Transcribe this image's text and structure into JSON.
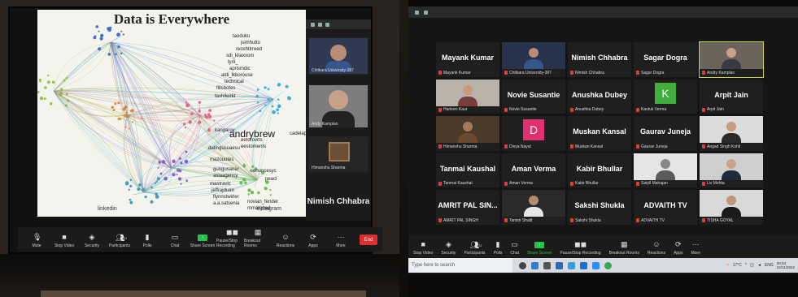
{
  "left": {
    "slide": {
      "title": "Data is Everywhere",
      "network_labels": [
        "taoduku",
        "jsimhutto",
        "reoshtlrreed",
        "sdi_kliaxxom",
        "tyrii_",
        "aprismdic",
        "aldi_lkborouse",
        "technical",
        "fillsbotes",
        "tashlleirkt",
        "kangaroy",
        "datingusuaesu",
        "mazouutes",
        "gungusaner",
        "asiaagency",
        "mastravic",
        "jeffrajduan",
        "flynnstwirler",
        "a.a.satsenia",
        "novian_fender",
        "mmatgbed",
        "cadelapmo",
        "eetorovrts",
        "senuncesyc",
        "peacl",
        "eestoments"
      ],
      "big_label": "andrybrew",
      "bottom_left": "linkedin",
      "bottom_right": "instagram"
    },
    "side_panel": {
      "tiles": [
        {
          "label": "Chitkara University-387"
        },
        {
          "label": "Andy Kamplan"
        },
        {
          "label": "Himanshu Sharma"
        }
      ],
      "big_name": "Nimish Chhabra"
    },
    "toolbar": [
      {
        "label": "Mute",
        "icon": "mic-icon"
      },
      {
        "label": "Stop Video",
        "icon": "video-icon"
      },
      {
        "label": "Security",
        "icon": "shield-icon"
      },
      {
        "label": "Participants",
        "icon": "people-icon",
        "count": "31"
      },
      {
        "label": "Polls",
        "icon": "polls-icon"
      },
      {
        "label": "Chat",
        "icon": "chat-icon"
      },
      {
        "label": "Share Screen",
        "icon": "share-icon"
      },
      {
        "label": "Pause/Stop Recording",
        "icon": "record-icon"
      },
      {
        "label": "Breakout Rooms",
        "icon": "rooms-icon"
      },
      {
        "label": "Reactions",
        "icon": "emoji-icon"
      },
      {
        "label": "Apps",
        "icon": "apps-icon"
      },
      {
        "label": "More",
        "icon": "more-icon"
      }
    ],
    "end_label": "End"
  },
  "right": {
    "tiles": [
      {
        "name": "Mayank Kumar",
        "label": "Mayank Kumar",
        "kind": "name"
      },
      {
        "name": "",
        "label": "Chitkara University-387",
        "kind": "video",
        "bg": "#27334a",
        "skin": "#b98c74",
        "shirt": "#36558a"
      },
      {
        "name": "Nimish Chhabra",
        "label": "Nimish Chhabra",
        "kind": "name"
      },
      {
        "name": "Sagar Dogra",
        "label": "Sagar Dogra",
        "kind": "name"
      },
      {
        "name": "",
        "label": "Andry Kamplan",
        "kind": "video",
        "bg": "#6b645b",
        "skin": "#caa08c",
        "shirt": "#3a3a44",
        "active": true
      },
      {
        "name": "",
        "label": "Harleen Kaur",
        "kind": "video",
        "bg": "#b8b2a8",
        "skin": "#c59a7f",
        "shirt": "#7a3c3c"
      },
      {
        "name": "Novie Susantie",
        "label": "Novie Susantie",
        "kind": "name"
      },
      {
        "name": "Anushka Dubey",
        "label": "Anushka Dubey",
        "kind": "name"
      },
      {
        "name": "",
        "label": "Kavtuk Verma",
        "kind": "avatar",
        "letter": "K",
        "color": "#3fae3a"
      },
      {
        "name": "Arpit Jain",
        "label": "Arpit Jain",
        "kind": "name"
      },
      {
        "name": "",
        "label": "Himanshu Sharma",
        "kind": "video",
        "bg": "#4a3a2a",
        "skin": "#a57a5b",
        "shirt": "#6b4a2e"
      },
      {
        "name": "",
        "label": "Divya Nayal",
        "kind": "avatar",
        "letter": "D",
        "color": "#e0306f"
      },
      {
        "name": "Muskan Kansal",
        "label": "Muskan Kansal",
        "kind": "name"
      },
      {
        "name": "Gaurav Juneja",
        "label": "Gaurav Juneja",
        "kind": "name"
      },
      {
        "name": "",
        "label": "Angad Singh Kohli",
        "kind": "video",
        "bg": "#dcdcdc",
        "skin": "#c79b7e",
        "shirt": "#2a2a2a"
      },
      {
        "name": "Tanmai Kaushal",
        "label": "Tanmai Kaushal",
        "kind": "name"
      },
      {
        "name": "Aman Verma",
        "label": "Aman Verma",
        "kind": "name"
      },
      {
        "name": "Kabir Bhullar",
        "label": "Kabir Bhullar",
        "kind": "name"
      },
      {
        "name": "",
        "label": "Satyll Mahajan",
        "kind": "video",
        "bg": "#e5e5e5",
        "skin": "#888888",
        "shirt": "#5a5a5a"
      },
      {
        "name": "",
        "label": "Liv Mehta",
        "kind": "video",
        "bg": "#cfcfcf",
        "skin": "#c8a38a",
        "shirt": "#1f2b3a"
      },
      {
        "name": "AMRIT PAL SIN...",
        "label": "AMRIT PAL SINGH",
        "kind": "name"
      },
      {
        "name": "",
        "label": "Tanish Shalit",
        "kind": "video",
        "bg": "#2a2a2a",
        "skin": "#b38a6c",
        "shirt": "#e6e6e6"
      },
      {
        "name": "Sakshi Shukla",
        "label": "Sakshi Shukla",
        "kind": "name"
      },
      {
        "name": "ADVAITH TV",
        "label": "ADVAITH TV",
        "kind": "name"
      },
      {
        "name": "",
        "label": "TISHA GOYAL",
        "kind": "video",
        "bg": "#d9d9d9",
        "skin": "#c09579",
        "shirt": "#1a1a1a"
      }
    ],
    "toolbar": [
      {
        "label": "Stop Video",
        "icon": "video-icon"
      },
      {
        "label": "Security",
        "icon": "shield-icon"
      },
      {
        "label": "Participants",
        "icon": "people-icon",
        "count": "31"
      },
      {
        "label": "Polls",
        "icon": "polls-icon"
      },
      {
        "label": "Chat",
        "icon": "chat-icon"
      },
      {
        "label": "Share Screen",
        "icon": "share-icon"
      },
      {
        "label": "Pause/Stop Recording",
        "icon": "record-icon"
      },
      {
        "label": "Breakout Rooms",
        "icon": "rooms-icon"
      },
      {
        "label": "Reactions",
        "icon": "emoji-icon"
      },
      {
        "label": "Apps",
        "icon": "apps-icon"
      },
      {
        "label": "More",
        "icon": "more-icon"
      }
    ],
    "taskbar": {
      "search_placeholder": "Type here to search",
      "weather": "17°C",
      "lang": "ENG",
      "time": "20:34",
      "date": "24/11/2022"
    }
  },
  "colors": {
    "zoom_bar": "#1b1b1b",
    "end_red": "#e02d2d",
    "share_green": "#27c24c",
    "active_outline": "#c9d33c"
  }
}
